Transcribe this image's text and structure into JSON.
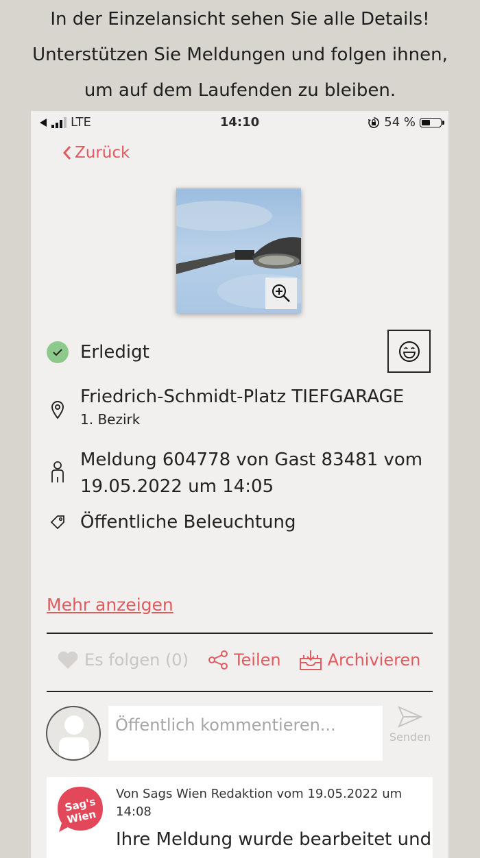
{
  "caption": {
    "line1": "In der Einzelansicht sehen Sie alle Details!",
    "line2": "Unterstützen Sie Meldungen und folgen ihnen,",
    "line3": "um auf dem Laufenden zu bleiben."
  },
  "statusbar": {
    "network": "LTE",
    "time": "14:10",
    "battery": "54 %",
    "battery_level": 0.54
  },
  "nav": {
    "back_label": "Zurück"
  },
  "report": {
    "status": "Erledigt",
    "address": "Friedrich-Schmidt-Platz TIEFGARAGE",
    "district": "1. Bezirk",
    "meta_line1": "Meldung 604778 von Gast 83481 vom",
    "meta_line2": "19.05.2022 um 14:05",
    "category": "Öffentliche Beleuchtung"
  },
  "more_link": "Mehr anzeigen",
  "actions": {
    "follow": "Es folgen (0)",
    "share": "Teilen",
    "archive": "Archivieren"
  },
  "comment": {
    "placeholder": "Öffentlich kommentieren...",
    "send_label": "Senden"
  },
  "feed": {
    "logo_text_1": "Sag's",
    "logo_text_2": "Wien",
    "meta": "Von Sags Wien Redaktion vom 19.05.2022 um 14:08",
    "text": "Ihre Meldung wurde bearbeitet und"
  },
  "colors": {
    "accent": "#e05a5e",
    "status_green": "#8cc98a",
    "background": "#d8d4ce",
    "screen": "#f2f0ee"
  }
}
